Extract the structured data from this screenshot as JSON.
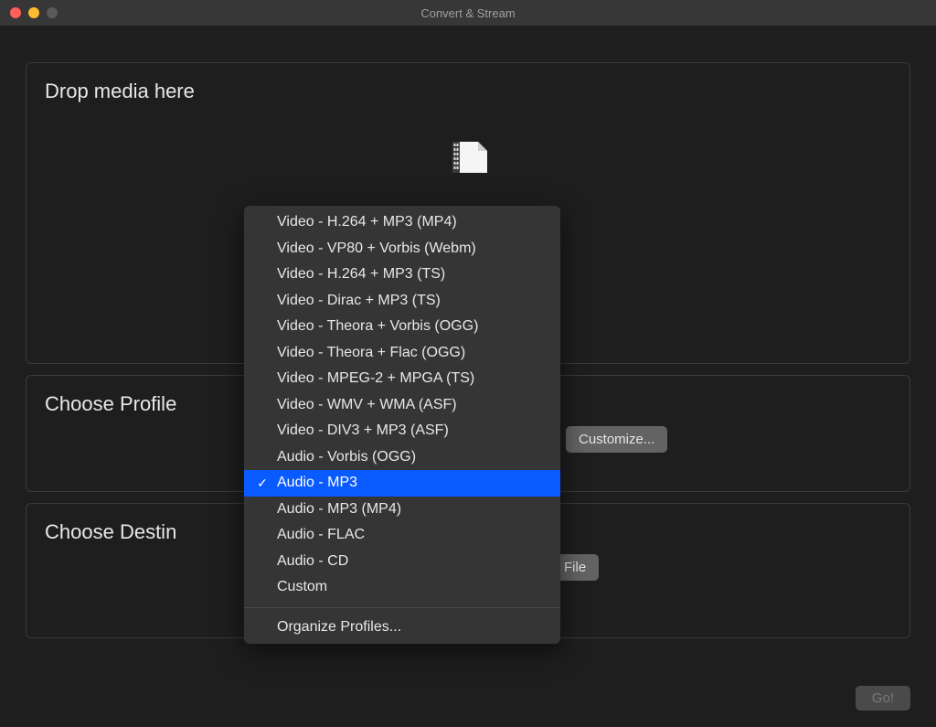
{
  "window": {
    "title": "Convert & Stream"
  },
  "drop": {
    "title": "Drop media here"
  },
  "profile": {
    "title": "Choose Profile",
    "customize_label": "Customize..."
  },
  "destination": {
    "title": "Choose Destin",
    "as_file_label": "as File"
  },
  "go_label": "Go!",
  "menu": {
    "items": [
      {
        "label": "Video - H.264 + MP3 (MP4)",
        "checked": false
      },
      {
        "label": "Video - VP80 + Vorbis (Webm)",
        "checked": false
      },
      {
        "label": "Video - H.264 + MP3 (TS)",
        "checked": false
      },
      {
        "label": "Video - Dirac + MP3 (TS)",
        "checked": false
      },
      {
        "label": "Video - Theora + Vorbis (OGG)",
        "checked": false
      },
      {
        "label": "Video - Theora + Flac (OGG)",
        "checked": false
      },
      {
        "label": "Video - MPEG-2 + MPGA (TS)",
        "checked": false
      },
      {
        "label": "Video - WMV + WMA (ASF)",
        "checked": false
      },
      {
        "label": "Video - DIV3 + MP3 (ASF)",
        "checked": false
      },
      {
        "label": "Audio - Vorbis (OGG)",
        "checked": false
      },
      {
        "label": "Audio - MP3",
        "checked": true
      },
      {
        "label": "Audio - MP3 (MP4)",
        "checked": false
      },
      {
        "label": "Audio - FLAC",
        "checked": false
      },
      {
        "label": "Audio - CD",
        "checked": false
      },
      {
        "label": "Custom",
        "checked": false
      }
    ],
    "footer": "Organize Profiles..."
  }
}
